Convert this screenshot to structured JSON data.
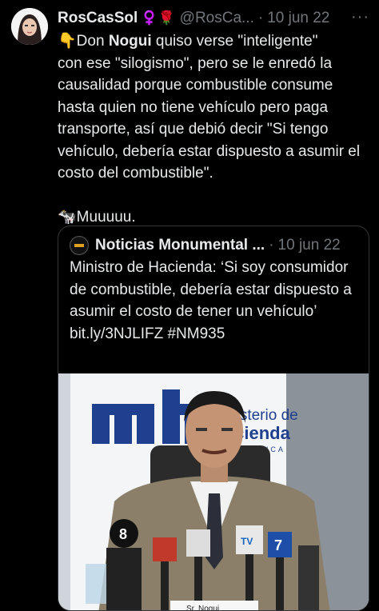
{
  "tweet": {
    "author_name": "RosCasSol",
    "author_emoji": "♀️🌹",
    "handle": "@RosCa...",
    "separator": "·",
    "date": "10 jun 22",
    "more_label": "···",
    "body_line1_emoji": "👇",
    "body_line1_pre": "Don ",
    "body_line1_bold": "Nogui",
    "body_line1_post": " quiso verse \"inteligente\"",
    "body_rest": "con ese \"silogismo\", pero se le enredó la causalidad porque combustible consume hasta quien no tiene vehículo pero paga transporte, así que debió decir \"Si tengo vehículo, debería estar dispuesto a asumir el costo del combustible\".",
    "body_closing_emoji": "🐄",
    "body_closing": "Muuuuu."
  },
  "quoted_tweet": {
    "author_name": "Noticias Monumental ...",
    "separator": "·",
    "date": "10 jun 22",
    "text": "Ministro de Hacienda: ‘Si soy consumidor de combustible, debería estar dispuesto a asumir el costo de tener un vehículo’ bit.ly/3NJLIFZ #NM935"
  },
  "photo": {
    "backdrop_logo": "mh",
    "backdrop_text_line1": "Ministerio de",
    "backdrop_text_line2": "Hacienda",
    "backdrop_text_line3": "COSTA RICA",
    "mic_labels": [
      "8",
      "7",
      "TV"
    ],
    "nameplate": "Sr. Nogui"
  },
  "colors": {
    "background": "#000000",
    "text_primary": "#e7e9ea",
    "text_secondary": "#71767b",
    "border": "#333639",
    "logo_blue": "#1f3f8f"
  }
}
